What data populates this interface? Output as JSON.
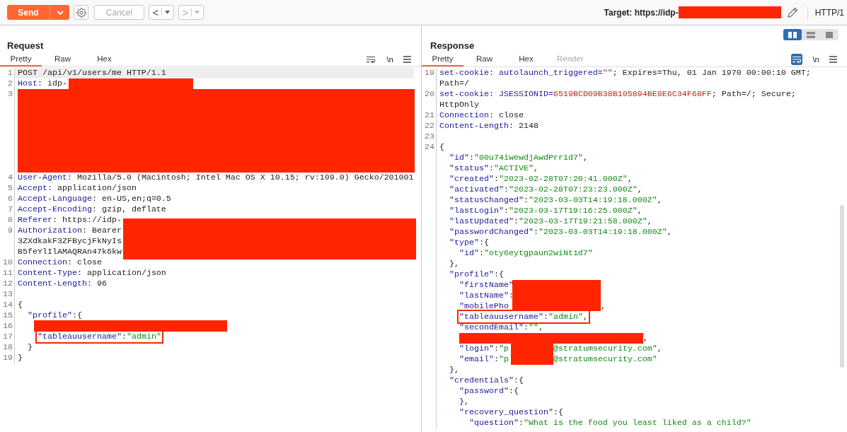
{
  "toolbar": {
    "send": "Send",
    "cancel": {
      "label": "Cancel",
      "disabled": true
    },
    "back": {
      "glyph": "<",
      "disabled": false
    },
    "forward": {
      "glyph": ">",
      "disabled": true
    },
    "target_label": "Target: https://idp-",
    "protocol": "HTTP/1"
  },
  "layout_modes": [
    {
      "selected": true
    },
    {
      "selected": false
    },
    {
      "selected": false
    }
  ],
  "request": {
    "title": "Request",
    "wrap_on": false,
    "newline": "\\n",
    "tabs": [
      {
        "label": "Pretty",
        "selected": true,
        "disabled": false
      },
      {
        "label": "Raw",
        "selected": false,
        "disabled": false
      },
      {
        "label": "Hex",
        "selected": false,
        "disabled": false
      }
    ],
    "rows": [
      {
        "number": "1",
        "current": true,
        "segments": [
          {
            "kind": "plain",
            "text": "POST /api/v1/users/me HTTP/1.1"
          }
        ]
      },
      {
        "number": "2",
        "current": false,
        "segments": [
          {
            "kind": "key",
            "text": "Host"
          },
          {
            "kind": "plain",
            "text": ": idp-"
          },
          {
            "kind": "redaction"
          }
        ]
      },
      {
        "number": "3",
        "current": false,
        "segments": [
          {
            "kind": "redaction"
          }
        ]
      },
      {
        "number": "4",
        "current": false,
        "segments": [
          {
            "kind": "key",
            "text": "User-Agent"
          },
          {
            "kind": "plain",
            "text": ": Mozilla/5.0 (Macintosh; Intel Mac OS X 10.15; rv:109.0) Gecko/201001"
          }
        ]
      },
      {
        "number": "5",
        "current": false,
        "segments": [
          {
            "kind": "key",
            "text": "Accept"
          },
          {
            "kind": "plain",
            "text": ": application/json"
          }
        ]
      },
      {
        "number": "6",
        "current": false,
        "segments": [
          {
            "kind": "key",
            "text": "Accept-Language"
          },
          {
            "kind": "plain",
            "text": ": en-US,en;q=0.5"
          }
        ]
      },
      {
        "number": "7",
        "current": false,
        "segments": [
          {
            "kind": "key",
            "text": "Accept-Encoding"
          },
          {
            "kind": "plain",
            "text": ": gzip, deflate"
          }
        ]
      },
      {
        "number": "8",
        "current": false,
        "segments": [
          {
            "kind": "key",
            "text": "Referer"
          },
          {
            "kind": "plain",
            "text": ": https://idp-"
          },
          {
            "kind": "redaction"
          }
        ]
      },
      {
        "number": "9",
        "current": false,
        "segments": [
          {
            "kind": "key",
            "text": "Authorization"
          },
          {
            "kind": "plain",
            "text": ": Bearer"
          }
        ]
      },
      {
        "current": false,
        "segments": [
          {
            "kind": "plain",
            "text": "3ZXdkakF3ZFBycjFkNyIs"
          }
        ]
      },
      {
        "current": false,
        "segments": [
          {
            "kind": "plain",
            "text": "B5feYlIlAMAQRAn47k6kw"
          }
        ]
      },
      {
        "number": "10",
        "current": false,
        "segments": [
          {
            "kind": "key",
            "text": "Connection"
          },
          {
            "kind": "plain",
            "text": ": close"
          }
        ]
      },
      {
        "number": "11",
        "current": false,
        "segments": [
          {
            "kind": "key",
            "text": "Content-Type"
          },
          {
            "kind": "plain",
            "text": ": application/json"
          }
        ]
      },
      {
        "number": "12",
        "current": false,
        "segments": [
          {
            "kind": "key",
            "text": "Content-Length"
          },
          {
            "kind": "plain",
            "text": ": 96"
          }
        ]
      },
      {
        "number": "13",
        "current": false
      },
      {
        "number": "14",
        "current": false,
        "segments": [
          {
            "kind": "plain",
            "text": "{"
          }
        ]
      },
      {
        "number": "15",
        "current": false,
        "segments": [
          {
            "kind": "key",
            "text": "  \"profile\""
          },
          {
            "kind": "plain",
            "text": ":{"
          }
        ]
      },
      {
        "number": "16",
        "current": false,
        "segments": [
          {
            "kind": "redaction"
          }
        ]
      },
      {
        "number": "17",
        "current": false,
        "segments": [
          {
            "kind": "outline",
            "tokens": [
              {
                "kind": "key",
                "text": "\"tableauusername\""
              },
              {
                "kind": "plain",
                "text": ":"
              },
              {
                "kind": "string",
                "text": "\"admin\""
              }
            ]
          }
        ]
      },
      {
        "number": "18",
        "current": false,
        "segments": [
          {
            "kind": "plain",
            "text": "  }"
          }
        ]
      },
      {
        "number": "19",
        "current": false,
        "segments": [
          {
            "kind": "plain",
            "text": "}"
          }
        ]
      }
    ]
  },
  "response": {
    "title": "Response",
    "wrap_on": true,
    "newline": "\\n",
    "tabs": [
      {
        "label": "Pretty",
        "selected": true,
        "disabled": false
      },
      {
        "label": "Raw",
        "selected": false,
        "disabled": false
      },
      {
        "label": "Hex",
        "selected": false,
        "disabled": false
      },
      {
        "label": "Render",
        "selected": false,
        "disabled": true
      }
    ],
    "rows": [
      {
        "number": "19",
        "segments": [
          {
            "kind": "key",
            "text": "set-cookie"
          },
          {
            "kind": "plain",
            "text": ": "
          },
          {
            "kind": "key",
            "text": "autolaunch_triggered="
          },
          {
            "kind": "value",
            "text": "\"\""
          },
          {
            "kind": "plain",
            "text": "; Expires=Thu, 01 Jan 1970 00:00:10 GMT;"
          }
        ]
      },
      {
        "segments": [
          {
            "kind": "plain",
            "text": "Path=/"
          }
        ]
      },
      {
        "number": "20",
        "segments": [
          {
            "kind": "key",
            "text": "set-cookie"
          },
          {
            "kind": "plain",
            "text": ": "
          },
          {
            "kind": "key",
            "text": "JSESSIONID="
          },
          {
            "kind": "value",
            "text": "6519BCD09B38B105894BE9E6C34F68FF"
          },
          {
            "kind": "plain",
            "text": "; Path=/; Secure;"
          }
        ]
      },
      {
        "segments": [
          {
            "kind": "plain",
            "text": "HttpOnly"
          }
        ]
      },
      {
        "number": "21",
        "segments": [
          {
            "kind": "key",
            "text": "Connection"
          },
          {
            "kind": "plain",
            "text": ": close"
          }
        ]
      },
      {
        "number": "22",
        "segments": [
          {
            "kind": "key",
            "text": "Content-Length"
          },
          {
            "kind": "plain",
            "text": ": 2148"
          }
        ]
      },
      {
        "number": "23"
      },
      {
        "number": "24",
        "segments": [
          {
            "kind": "plain",
            "text": "{"
          }
        ]
      },
      {
        "segments": [
          {
            "kind": "key",
            "text": "  \"id\""
          },
          {
            "kind": "plain",
            "text": ":"
          },
          {
            "kind": "string",
            "text": "\"00u74iwewdjAwdPrr1d7\""
          },
          {
            "kind": "plain",
            "text": ","
          }
        ]
      },
      {
        "segments": [
          {
            "kind": "key",
            "text": "  \"status\""
          },
          {
            "kind": "plain",
            "text": ":"
          },
          {
            "kind": "string",
            "text": "\"ACTIVE\""
          },
          {
            "kind": "plain",
            "text": ","
          }
        ]
      },
      {
        "segments": [
          {
            "kind": "key",
            "text": "  \"created\""
          },
          {
            "kind": "plain",
            "text": ":"
          },
          {
            "kind": "string",
            "text": "\"2023-02-28T07:20:41.000Z\""
          },
          {
            "kind": "plain",
            "text": ","
          }
        ]
      },
      {
        "segments": [
          {
            "kind": "key",
            "text": "  \"activated\""
          },
          {
            "kind": "plain",
            "text": ":"
          },
          {
            "kind": "string",
            "text": "\"2023-02-28T07:23:23.000Z\""
          },
          {
            "kind": "plain",
            "text": ","
          }
        ]
      },
      {
        "segments": [
          {
            "kind": "key",
            "text": "  \"statusChanged\""
          },
          {
            "kind": "plain",
            "text": ":"
          },
          {
            "kind": "string",
            "text": "\"2023-03-03T14:19:18.000Z\""
          },
          {
            "kind": "plain",
            "text": ","
          }
        ]
      },
      {
        "segments": [
          {
            "kind": "key",
            "text": "  \"lastLogin\""
          },
          {
            "kind": "plain",
            "text": ":"
          },
          {
            "kind": "string",
            "text": "\"2023-03-17T19:16:25.000Z\""
          },
          {
            "kind": "plain",
            "text": ","
          }
        ]
      },
      {
        "segments": [
          {
            "kind": "key",
            "text": "  \"lastUpdated\""
          },
          {
            "kind": "plain",
            "text": ":"
          },
          {
            "kind": "string",
            "text": "\"2023-03-17T19:21:58.000Z\""
          },
          {
            "kind": "plain",
            "text": ","
          }
        ]
      },
      {
        "segments": [
          {
            "kind": "key",
            "text": "  \"passwordChanged\""
          },
          {
            "kind": "plain",
            "text": ":"
          },
          {
            "kind": "string",
            "text": "\"2023-03-03T14:19:18.000Z\""
          },
          {
            "kind": "plain",
            "text": ","
          }
        ]
      },
      {
        "segments": [
          {
            "kind": "key",
            "text": "  \"type\""
          },
          {
            "kind": "plain",
            "text": ":{"
          }
        ]
      },
      {
        "segments": [
          {
            "kind": "key",
            "text": "    \"id\""
          },
          {
            "kind": "plain",
            "text": ":"
          },
          {
            "kind": "string",
            "text": "\"oty6eytgpaun2wiNt1d7\""
          }
        ]
      },
      {
        "segments": [
          {
            "kind": "plain",
            "text": "  },"
          }
        ]
      },
      {
        "segments": [
          {
            "kind": "key",
            "text": "  \"profile\""
          },
          {
            "kind": "plain",
            "text": ":{"
          }
        ]
      },
      {
        "segments": [
          {
            "kind": "key",
            "text": "    \"firstName\""
          }
        ]
      },
      {
        "segments": [
          {
            "kind": "key",
            "text": "    \"lastName\""
          },
          {
            "kind": "plain",
            "text": ":"
          }
        ]
      },
      {
        "segments": [
          {
            "kind": "key",
            "text": "    \"mobilePho"
          },
          {
            "kind": "redaction"
          },
          {
            "kind": "plain",
            "text": ","
          }
        ]
      },
      {
        "segments": [
          {
            "kind": "outline",
            "tokens": [
              {
                "kind": "key",
                "text": "\"tableauusername\""
              },
              {
                "kind": "plain",
                "text": ":"
              },
              {
                "kind": "string",
                "text": "\"admin\""
              },
              {
                "kind": "plain",
                "text": ","
              }
            ]
          }
        ]
      },
      {
        "segments": [
          {
            "kind": "key",
            "text": "    \"secondEmail\""
          },
          {
            "kind": "plain",
            "text": ":"
          },
          {
            "kind": "string",
            "text": "\"\""
          },
          {
            "kind": "plain",
            "text": ","
          }
        ]
      },
      {
        "segments": [
          {
            "kind": "redaction"
          },
          {
            "kind": "plain",
            "text": ","
          }
        ]
      },
      {
        "segments": [
          {
            "kind": "key",
            "text": "    \"login\""
          },
          {
            "kind": "plain",
            "text": ":"
          },
          {
            "kind": "string",
            "text": "\"p"
          },
          {
            "kind": "redaction"
          },
          {
            "kind": "string",
            "text": "@stratumsecurity.com\""
          },
          {
            "kind": "plain",
            "text": ","
          }
        ]
      },
      {
        "segments": [
          {
            "kind": "key",
            "text": "    \"email\""
          },
          {
            "kind": "plain",
            "text": ":"
          },
          {
            "kind": "string",
            "text": "\"p"
          },
          {
            "kind": "gap"
          },
          {
            "kind": "string",
            "text": "@stratumsecurity.com\""
          }
        ]
      },
      {
        "segments": [
          {
            "kind": "plain",
            "text": "  },"
          }
        ]
      },
      {
        "segments": [
          {
            "kind": "key",
            "text": "  \"credentials\""
          },
          {
            "kind": "plain",
            "text": ":{"
          }
        ]
      },
      {
        "segments": [
          {
            "kind": "key",
            "text": "    \"password\""
          },
          {
            "kind": "plain",
            "text": ":{"
          }
        ]
      },
      {
        "segments": [
          {
            "kind": "plain",
            "text": "    },"
          }
        ]
      },
      {
        "segments": [
          {
            "kind": "key",
            "text": "    \"recovery_question\""
          },
          {
            "kind": "plain",
            "text": ":{"
          }
        ]
      },
      {
        "segments": [
          {
            "kind": "key",
            "text": "      \"question\""
          },
          {
            "kind": "plain",
            "text": ":"
          },
          {
            "kind": "string",
            "text": "\"What is the food you least liked as a child?\""
          }
        ]
      }
    ]
  }
}
